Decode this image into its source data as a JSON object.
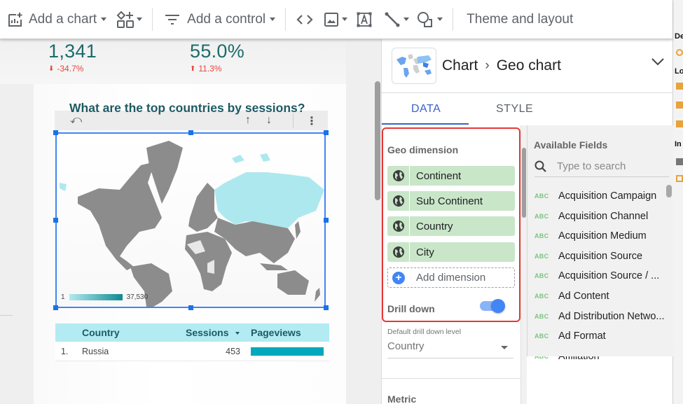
{
  "toolbar": {
    "add_chart": "Add a chart",
    "add_control": "Add a control",
    "theme_layout": "Theme and layout",
    "icons": [
      "add-chart-icon",
      "add-component-icon",
      "filter-icon",
      "code-embed-icon",
      "image-icon",
      "text-box-icon",
      "line-icon",
      "shape-icon"
    ]
  },
  "scorecards": [
    {
      "value": "1,341",
      "delta": "-34.7%",
      "direction": "down"
    },
    {
      "value": "55.0%",
      "delta": "11.3%",
      "direction": "up"
    }
  ],
  "chart": {
    "title": "What are the top countries by sessions?",
    "legend_min": "1",
    "legend_max": "37,530",
    "highlighted_country": "Russia",
    "colors": {
      "highlight": "#aee8ef",
      "land": "#8c8c8c",
      "legend_start": "#b3e9ef",
      "legend_end": "#0e8a8f"
    }
  },
  "table": {
    "columns": [
      "Country",
      "Sessions",
      "Pageviews"
    ],
    "sort_column": "Sessions",
    "rows": [
      {
        "index": "1.",
        "country": "Russia",
        "sessions": "453",
        "pageviews_fraction": 1.0
      }
    ]
  },
  "panel": {
    "breadcrumb": {
      "root": "Chart",
      "current": "Geo chart"
    },
    "tabs": [
      {
        "label": "DATA",
        "active": true
      },
      {
        "label": "STYLE",
        "active": false
      }
    ],
    "geo_dimension": {
      "title": "Geo dimension",
      "items": [
        "Continent",
        "Sub Continent",
        "Country",
        "City"
      ],
      "add_label": "Add dimension"
    },
    "drill_down": {
      "label": "Drill down",
      "enabled": true
    },
    "default_drill": {
      "label": "Default drill down level",
      "value": "Country"
    },
    "metric_title": "Metric",
    "available_fields": {
      "title": "Available Fields",
      "search_placeholder": "Type to search",
      "type_badge": "ABC",
      "items": [
        "Acquisition Campaign",
        "Acquisition Channel",
        "Acquisition Medium",
        "Acquisition Source",
        "Acquisition Source / ...",
        "Ad Content",
        "Ad Distribution Netwo...",
        "Ad Format",
        "Affiliation"
      ]
    }
  },
  "right_strip": {
    "labels": [
      "De",
      "Lo",
      "In"
    ]
  }
}
